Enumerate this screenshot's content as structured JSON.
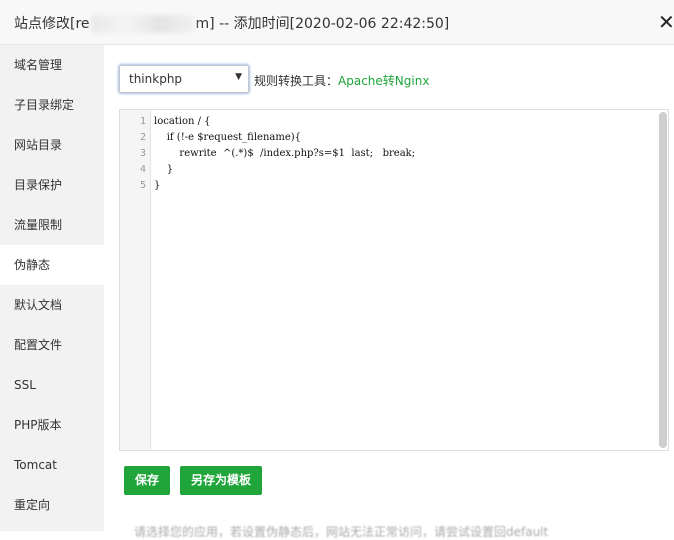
{
  "dialog": {
    "title_prefix": "站点修改[re",
    "title_mid": "m]",
    "title_suffix": " -- 添加时间[2020-02-06 22:42:50]",
    "close_glyph": "✕"
  },
  "sidebar": {
    "items": [
      {
        "label": "域名管理"
      },
      {
        "label": "子目录绑定"
      },
      {
        "label": "网站目录"
      },
      {
        "label": "目录保护"
      },
      {
        "label": "流量限制"
      },
      {
        "label": "伪静态",
        "active": true
      },
      {
        "label": "默认文档"
      },
      {
        "label": "配置文件"
      },
      {
        "label": "SSL"
      },
      {
        "label": "PHP版本"
      },
      {
        "label": "Tomcat"
      },
      {
        "label": "重定向"
      }
    ]
  },
  "rewrite": {
    "template_select": {
      "selected": "thinkphp"
    },
    "tool_label": "规则转换工具：",
    "tool_link": "Apache转Nginx",
    "editor": {
      "lines": [
        {
          "n": "1",
          "text": "location / {"
        },
        {
          "n": "2",
          "text": "    if (!-e $request_filename){"
        },
        {
          "n": "3",
          "text": "        rewrite  ^(.*)$  /index.php?s=$1  last;   break;"
        },
        {
          "n": "4",
          "text": "    }"
        },
        {
          "n": "5",
          "text": "}"
        }
      ]
    },
    "save_label": "保存",
    "save_as_template_label": "另存为模板",
    "tip": "请选择您的应用，若设置伪静态后，网站无法正常访问，请尝试设置回default"
  }
}
